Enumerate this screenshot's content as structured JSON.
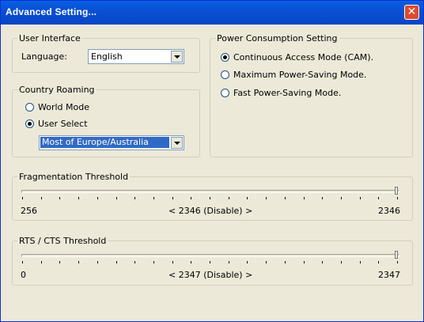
{
  "window": {
    "title": "Advanced Setting...",
    "close_glyph": "✕"
  },
  "user_interface": {
    "legend": "User Interface",
    "language_label": "Language:",
    "language_value": "English"
  },
  "country_roaming": {
    "legend": "Country Roaming",
    "options": [
      {
        "label": "World Mode",
        "selected": false
      },
      {
        "label": "User Select",
        "selected": true
      }
    ],
    "region_value": "Most of Europe/Australia"
  },
  "power": {
    "legend": "Power Consumption Setting",
    "options": [
      {
        "label": "Continuous Access Mode (CAM).",
        "selected": true
      },
      {
        "label": "Maximum Power-Saving Mode.",
        "selected": false
      },
      {
        "label": "Fast Power-Saving Mode.",
        "selected": false
      }
    ]
  },
  "fragmentation": {
    "legend": "Fragmentation Threshold",
    "min_label": "256",
    "max_label": "2346",
    "value_label": "< 2346 (Disable) >",
    "value": 2346,
    "min": 256,
    "max": 2346
  },
  "rts": {
    "legend": "RTS / CTS Threshold",
    "min_label": "0",
    "max_label": "2347",
    "value_label": "< 2347 (Disable) >",
    "value": 2347,
    "min": 0,
    "max": 2347
  }
}
